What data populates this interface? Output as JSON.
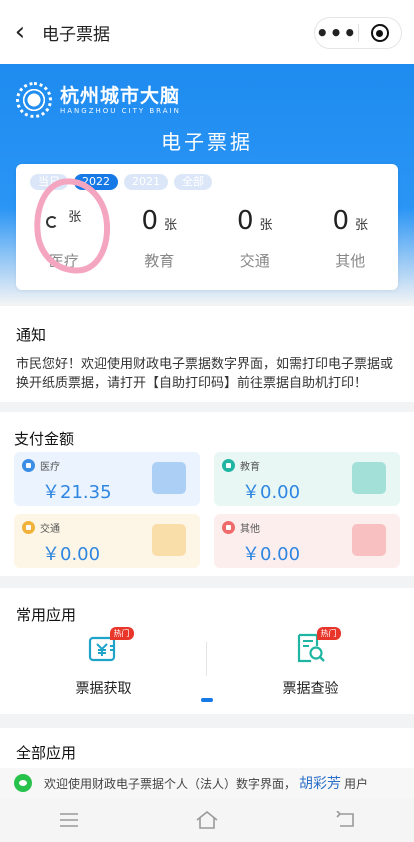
{
  "topbar": {
    "title": "电子票据",
    "back_glyph": "‹",
    "more_glyph": "•••"
  },
  "hero": {
    "logo_cn": "杭州城市大脑",
    "logo_en": "HANGZHOU CITY BRAIN",
    "title": "电子票据"
  },
  "tabs": [
    {
      "label": "当日",
      "active": false
    },
    {
      "label": "2022",
      "active": true
    },
    {
      "label": "2021",
      "active": false
    },
    {
      "label": "全部",
      "active": false
    }
  ],
  "counts": [
    {
      "value": "",
      "unit": "张",
      "label": "医疗",
      "loading": true
    },
    {
      "value": "0",
      "unit": "张",
      "label": "教育"
    },
    {
      "value": "0",
      "unit": "张",
      "label": "交通"
    },
    {
      "value": "0",
      "unit": "张",
      "label": "其他"
    }
  ],
  "notice": {
    "title": "通知",
    "text": "市民您好！欢迎使用财政电子票据数字界面，如需打印电子票据或换开纸质票据，请打开【自助打印码】前往票据自助机打印！"
  },
  "payments": {
    "title": "支付金额",
    "items": [
      {
        "label": "医疗",
        "amount": "￥21.35",
        "color": "#3a8ee6",
        "bg": "#eaf3fe",
        "amount_color": "#2f86e0"
      },
      {
        "label": "教育",
        "amount": "￥0.00",
        "color": "#1fb5a2",
        "bg": "#e8f7f4",
        "amount_color": "#2f86e0"
      },
      {
        "label": "交通",
        "amount": "￥0.00",
        "color": "#f0b23a",
        "bg": "#fdf6e6",
        "amount_color": "#2f86e0"
      },
      {
        "label": "其他",
        "amount": "￥0.00",
        "color": "#ef6b6b",
        "bg": "#fdeeee",
        "amount_color": "#2f86e0"
      }
    ]
  },
  "common": {
    "title": "常用应用",
    "apps": [
      {
        "label": "票据获取",
        "badge": "热门",
        "icon": "yuan-ticket-icon"
      },
      {
        "label": "票据查验",
        "badge": "热门",
        "icon": "ticket-search-icon"
      }
    ]
  },
  "all_apps": {
    "title": "全部应用"
  },
  "footer": {
    "text_before": "欢迎使用财政电子票据个人（法人）数字界面，",
    "name": "胡彩芳",
    "text_after": " 用户"
  },
  "colors": {
    "accent": "#1679e6",
    "hero": "#1e8bf0",
    "hot": "#e8362a"
  }
}
